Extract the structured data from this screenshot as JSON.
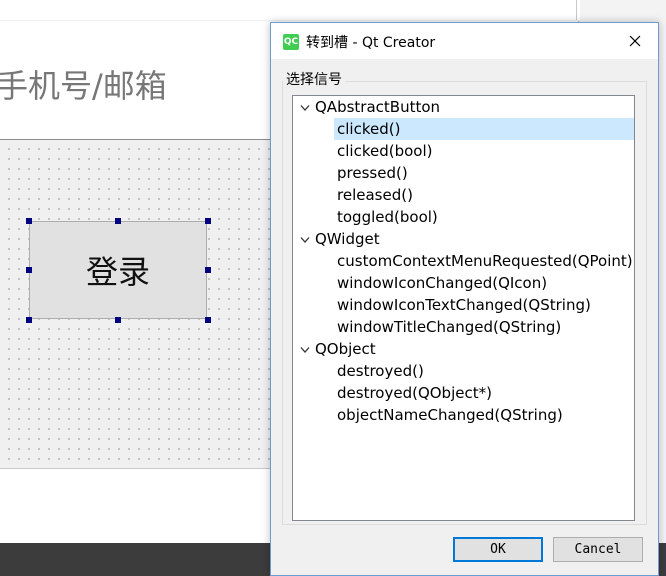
{
  "designer": {
    "placeholder": "手机号/邮箱",
    "login_button": "登录"
  },
  "dialog": {
    "title": "转到槽 - Qt Creator",
    "app_icon": "QC",
    "close_icon": "close-icon",
    "group_label": "选择信号",
    "tree": {
      "groups": [
        {
          "name": "QAbstractButton",
          "signals": [
            "clicked()",
            "clicked(bool)",
            "pressed()",
            "released()",
            "toggled(bool)"
          ]
        },
        {
          "name": "QWidget",
          "signals": [
            "customContextMenuRequested(QPoint)",
            "windowIconChanged(QIcon)",
            "windowIconTextChanged(QString)",
            "windowTitleChanged(QString)"
          ]
        },
        {
          "name": "QObject",
          "signals": [
            "destroyed()",
            "destroyed(QObject*)",
            "objectNameChanged(QString)"
          ]
        }
      ],
      "selected": "clicked()"
    },
    "ok_label": "OK",
    "cancel_label": "Cancel"
  },
  "colors": {
    "selection": "#cce8ff",
    "handle": "#000080",
    "default_button_border": "#0078d7",
    "qt_green": "#41cd52"
  }
}
